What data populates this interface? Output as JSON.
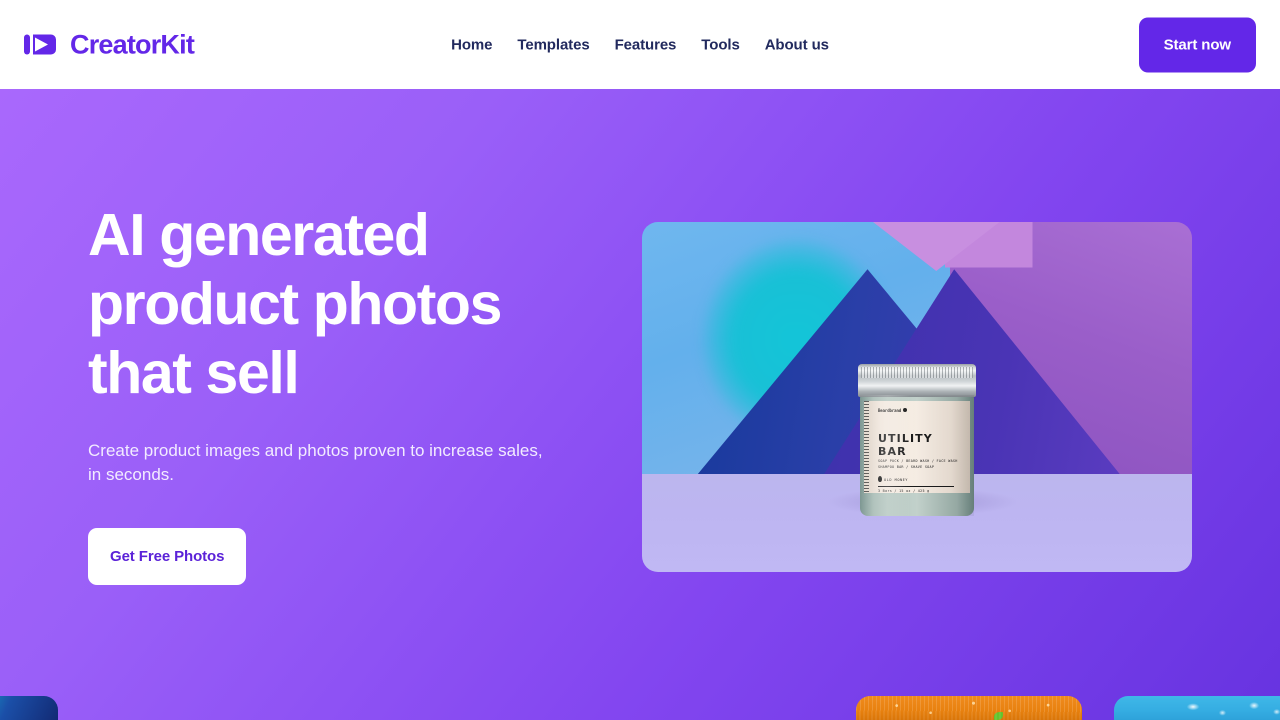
{
  "header": {
    "brand": {
      "name": "CreatorKit",
      "icon": "video-play-logo-icon",
      "color": "#6327e8"
    },
    "nav": [
      {
        "label": "Home"
      },
      {
        "label": "Templates"
      },
      {
        "label": "Features"
      },
      {
        "label": "Tools"
      },
      {
        "label": "About us"
      }
    ],
    "cta": {
      "label": "Start now",
      "bg": "#6327e8",
      "color": "#ffffff"
    }
  },
  "hero": {
    "title": "AI generated product photos that sell",
    "subtitle": "Create product images and photos proven to increase sales, in seconds.",
    "cta": {
      "label": "Get Free Photos",
      "bg": "#ffffff",
      "color": "#5b22d8"
    },
    "background": {
      "from": "#a968fc",
      "to": "#6733e0"
    },
    "image": {
      "alt": "AI generated product photo of a Beardbrand Utility Bar jar on a blue and purple geometric backdrop",
      "product_label": {
        "brand": "Beardbrand",
        "title_line1": "UTILITY",
        "title_line2": "BAR",
        "desc_line1": "SOAP PUCK / BEARD WASH / FACE WASH",
        "desc_line2": "SHAMPOO BAR / SHAVE SOAP",
        "scent": "OLD MONEY",
        "spec": "3 Bars / 15 oz / 425 g"
      }
    }
  },
  "carousel": {
    "cards": [
      {
        "name": "card-teal-blue"
      },
      {
        "name": "card-orange"
      },
      {
        "name": "card-sky-blue"
      }
    ]
  }
}
